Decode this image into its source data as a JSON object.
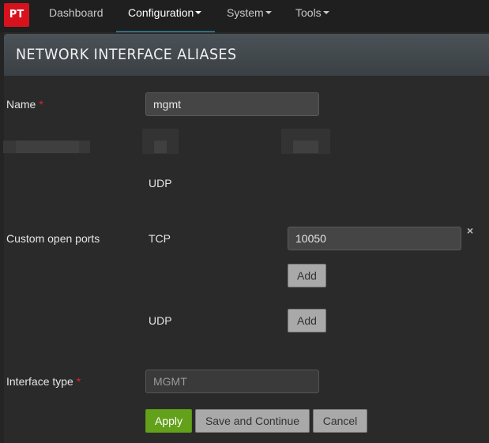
{
  "nav": {
    "logo": "PT",
    "items": [
      {
        "label": "Dashboard",
        "has_caret": false
      },
      {
        "label": "Configuration",
        "has_caret": true
      },
      {
        "label": "System",
        "has_caret": true
      },
      {
        "label": "Tools",
        "has_caret": true
      }
    ],
    "active_item": "Configuration"
  },
  "page": {
    "title": "NETWORK INTERFACE ALIASES"
  },
  "form": {
    "name_label": "Name",
    "name_required": "*",
    "name_value": "mgmt",
    "udp_label_top": "UDP",
    "custom_ports_label": "Custom open ports",
    "tcp_label": "TCP",
    "tcp_port_value": "10050",
    "tcp_add_label": "Add",
    "udp_label": "UDP",
    "udp_add_label": "Add",
    "interface_type_label": "Interface type",
    "interface_type_required": "*",
    "interface_type_value": "MGMT",
    "remove_icon": "×"
  },
  "actions": {
    "apply": "Apply",
    "save_continue": "Save and Continue",
    "cancel": "Cancel"
  },
  "colors": {
    "brand_red": "#d8121c",
    "apply_green": "#63a11a",
    "required_red": "#e02424",
    "active_underline": "#2f6f7e"
  }
}
